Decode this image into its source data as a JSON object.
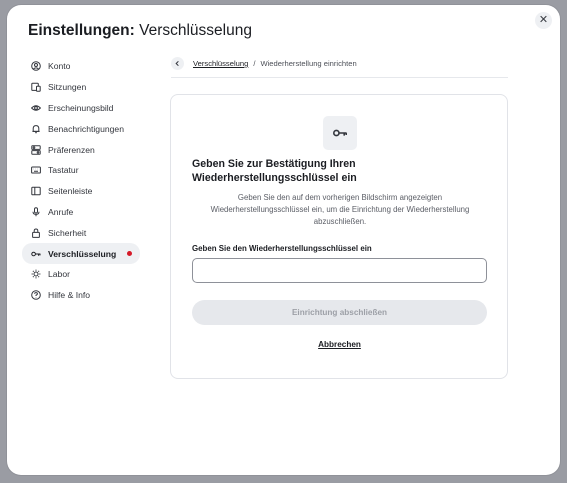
{
  "dialog": {
    "title_bold": "Einstellungen:",
    "title_rest": " Verschlüsselung",
    "close_icon": "close-icon"
  },
  "sidebar": {
    "items": [
      {
        "label": "Konto",
        "icon": "user-icon"
      },
      {
        "label": "Sitzungen",
        "icon": "devices-icon"
      },
      {
        "label": "Erscheinungsbild",
        "icon": "eye-icon"
      },
      {
        "label": "Benachrichtigungen",
        "icon": "bell-icon"
      },
      {
        "label": "Präferenzen",
        "icon": "preferences-icon"
      },
      {
        "label": "Tastatur",
        "icon": "keyboard-icon"
      },
      {
        "label": "Seitenleiste",
        "icon": "sidebar-icon"
      },
      {
        "label": "Anrufe",
        "icon": "microphone-icon"
      },
      {
        "label": "Sicherheit",
        "icon": "lock-icon"
      },
      {
        "label": "Verschlüsselung",
        "icon": "key-icon",
        "active": true,
        "alert_dot": "#d51928"
      },
      {
        "label": "Labor",
        "icon": "lightbulb-icon"
      },
      {
        "label": "Hilfe & Info",
        "icon": "help-icon"
      }
    ]
  },
  "breadcrumb": {
    "back_icon": "chevron-left-icon",
    "link": "Verschlüsselung",
    "separator": "/",
    "current": "Wiederherstellung einrichten"
  },
  "card": {
    "icon": "key-icon",
    "title": "Geben Sie zur Bestätigung Ihren Wiederherstellungsschlüssel ein",
    "description": "Geben Sie den auf dem vorherigen Bildschirm angezeigten Wiederherstellungsschlüssel ein, um die Einrichtung der Wiederherstellung abzuschließen.",
    "field_label": "Geben Sie den Wiederherstellungsschlüssel ein",
    "field_value": "",
    "finish_button": "Einrichtung abschließen",
    "cancel_button": "Abbrechen"
  },
  "colors": {
    "accent_dot": "#d51928",
    "disabled_button_bg": "#e6e8ec",
    "disabled_button_text": "#9da0a7",
    "active_item_bg": "#eef0f3"
  }
}
